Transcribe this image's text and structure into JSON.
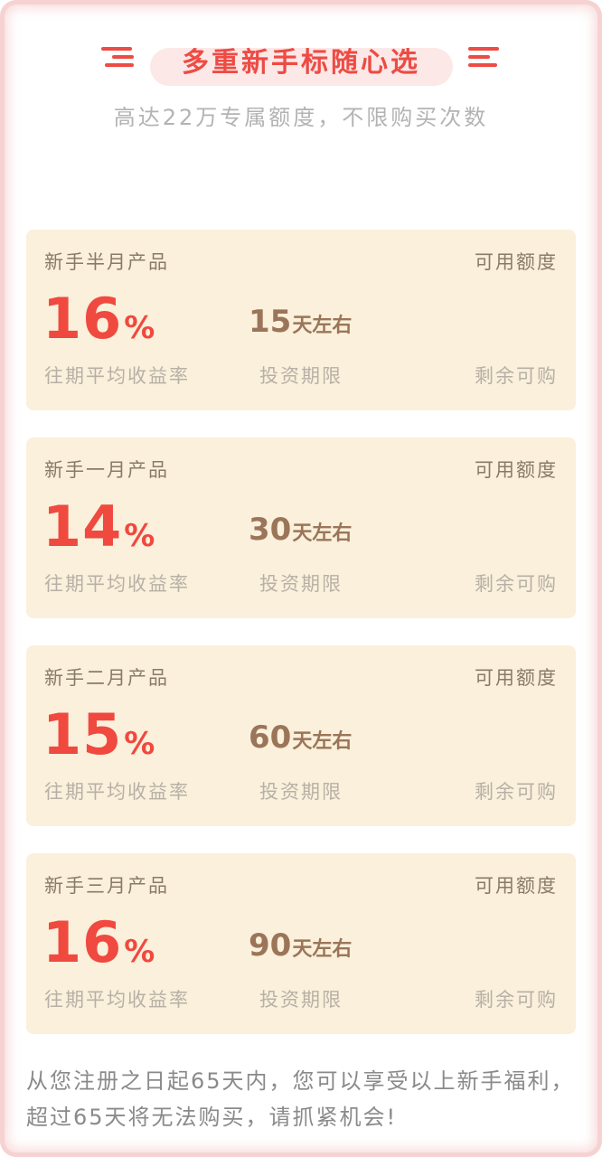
{
  "header": {
    "title": "多重新手标随心选",
    "subtitle": "高达22万专属额度，不限购买次数"
  },
  "products": [
    {
      "name": "新手半月产品",
      "quota_label": "可用额度",
      "rate": "16",
      "rate_unit": "%",
      "term": "15",
      "term_unit": "天左右",
      "rate_label": "往期平均收益率",
      "term_label": "投资期限",
      "remain_label": "剩余可购"
    },
    {
      "name": "新手一月产品",
      "quota_label": "可用额度",
      "rate": "14",
      "rate_unit": "%",
      "term": "30",
      "term_unit": "天左右",
      "rate_label": "往期平均收益率",
      "term_label": "投资期限",
      "remain_label": "剩余可购"
    },
    {
      "name": "新手二月产品",
      "quota_label": "可用额度",
      "rate": "15",
      "rate_unit": "%",
      "term": "60",
      "term_unit": "天左右",
      "rate_label": "往期平均收益率",
      "term_label": "投资期限",
      "remain_label": "剩余可购"
    },
    {
      "name": "新手三月产品",
      "quota_label": "可用额度",
      "rate": "16",
      "rate_unit": "%",
      "term": "90",
      "term_unit": "天左右",
      "rate_label": "往期平均收益率",
      "term_label": "投资期限",
      "remain_label": "剩余可购"
    }
  ],
  "footer": {
    "note": "从您注册之日起65天内，您可以享受以上新手福利，超过65天将无法购买，请抓紧机会!"
  },
  "colors": {
    "accent": "#ee4b44",
    "card_bg": "#faf0db",
    "term_color": "#9b7559"
  }
}
